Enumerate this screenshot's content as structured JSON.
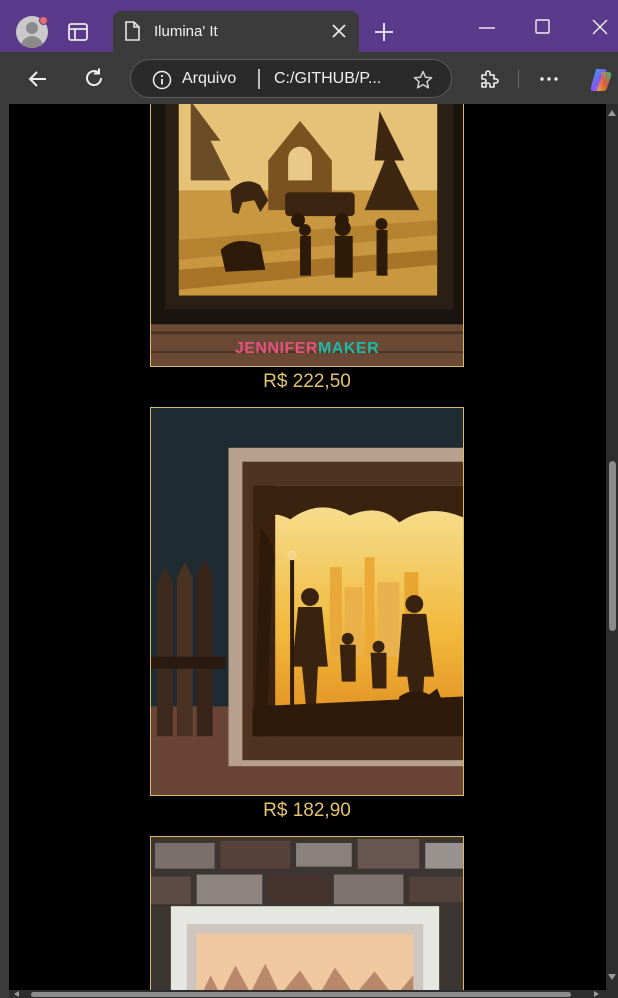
{
  "browser": {
    "tab_title": "Ilumina' It",
    "address_site_label": "Arquivo",
    "address_url": "C:/GITHUB/P...",
    "colors": {
      "frame": "#5b3a8c",
      "toolbar": "#3b3b3b"
    }
  },
  "products": [
    {
      "price": "R$ 222,50",
      "watermark": "JENNIFERMAKER"
    },
    {
      "price": "R$ 182,90"
    },
    {
      "price": ""
    }
  ],
  "theme": {
    "price_color": "#e3c26d",
    "border_color": "#d9b96a",
    "page_bg": "#000000"
  }
}
